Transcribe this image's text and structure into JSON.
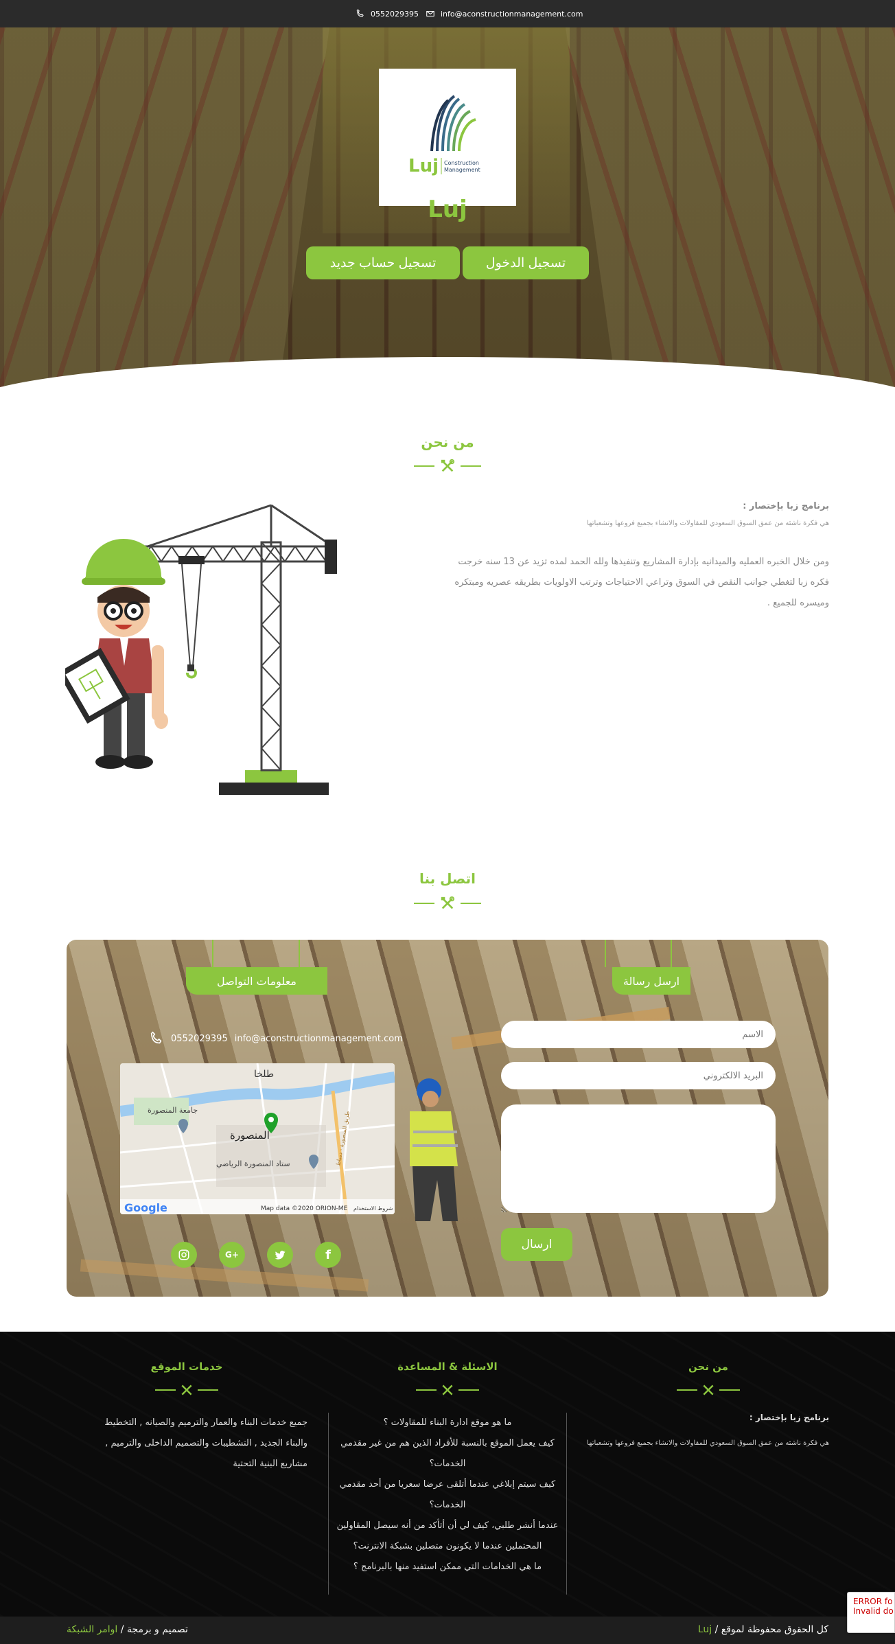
{
  "topbar": {
    "phone": "0552029395",
    "email": "info@aconstructionmanagement.com"
  },
  "hero": {
    "brand": "Luj",
    "logo_main": "Luj",
    "logo_sub1": "Construction",
    "logo_sub2": "Management",
    "login_label": "تسجيل الدخول",
    "register_label": "تسجيل حساب جديد"
  },
  "about": {
    "title": "من نحن",
    "lead": "برنامج زبا بإختصار :",
    "subtitle": "هي فكرة ناشئه من عمق السوق السعودي للمقاولات والانشاء بجميع فروعها وتشعباتها",
    "body": "ومن خلال الخبره العمليه والميدانيه بإدارة المشاريع وتنفيذها ولله الحمد لمده تزيد عن 13 سنه خرجت فكره زبا لتغطي جوانب النقص في السوق وتراعي الاحتياجات وترتب الاولويات بطريقه عصريه ومبتكره وميسره للجميع ."
  },
  "contact": {
    "title": "اتصل بنا",
    "info_tab": "معلومات التواصل",
    "message_tab": "ارسل رسالة",
    "phone": "0552029395",
    "email": "info@aconstructionmanagement.com",
    "map": {
      "label_talkha": "طلخا",
      "label_university": "جامعة المنصورة",
      "label_city": "المنصورة",
      "label_stadium": "ستاد المنصورة الرياضي",
      "label_road": "طريق المنصورة - دمياط",
      "label_terms": "شروط الاستخدام",
      "map_data": "Map data ©2020 ORION-ME",
      "google": "Google"
    },
    "name_placeholder": "الاسم",
    "email_placeholder": "البريد الالكتروني",
    "send_label": "ارسال",
    "social": [
      "instagram-icon",
      "google-plus-icon",
      "twitter-icon",
      "facebook-icon"
    ],
    "social_glyphs": {
      "gplus": "G+",
      "facebook": "f"
    }
  },
  "footer": {
    "services_title": "خدمات الموقع",
    "services_text": "جميع خدمات البناء والعمار والترميم والصيانه , التخطيط والبناء الجديد , التشطيبات والتصميم الداخلى والترميم , مشاريع البنية التحتية",
    "faq_title": "الاسئلة & المساعدة",
    "faq": [
      "ما هو موقع ادارة البناء للمقاولات ؟",
      "كيف يعمل الموقع بالنسبة للأفراد الذين هم من غير مقدمي الخدمات؟",
      "كيف سيتم إبلاغي عندما أتلقى عرضا سعريا من أحد مقدمي الخدمات؟",
      "عندما أنشر طلبي، كيف لي أن أتأكد من أنه سيصل المقاولين المحتملين عندما لا يكونون متصلين بشبكة الانترنت؟",
      "ما هي الخدامات التي ممكن استفيد منها بالبرنامج ؟"
    ],
    "about_title": "من نحن",
    "about_lead": "برنامج زبا بإختصار :",
    "about_text": "هي فكرة ناشئه من عمق السوق السعودي للمقاولات والانشاء بجميع فروعها وتشعباتها"
  },
  "bottombar": {
    "rights_prefix": "كل الحقوق محفوظة لموقع /",
    "rights_brand": "Luj",
    "design_prefix": "تصميم و برمجة /",
    "design_brand": "اوامر الشبكة"
  },
  "recaptcha": {
    "line1": "ERROR fo",
    "line2": "Invalid do"
  },
  "colors": {
    "accent": "#8cc63f",
    "dark": "#2b2b2b",
    "footer": "#111111"
  }
}
